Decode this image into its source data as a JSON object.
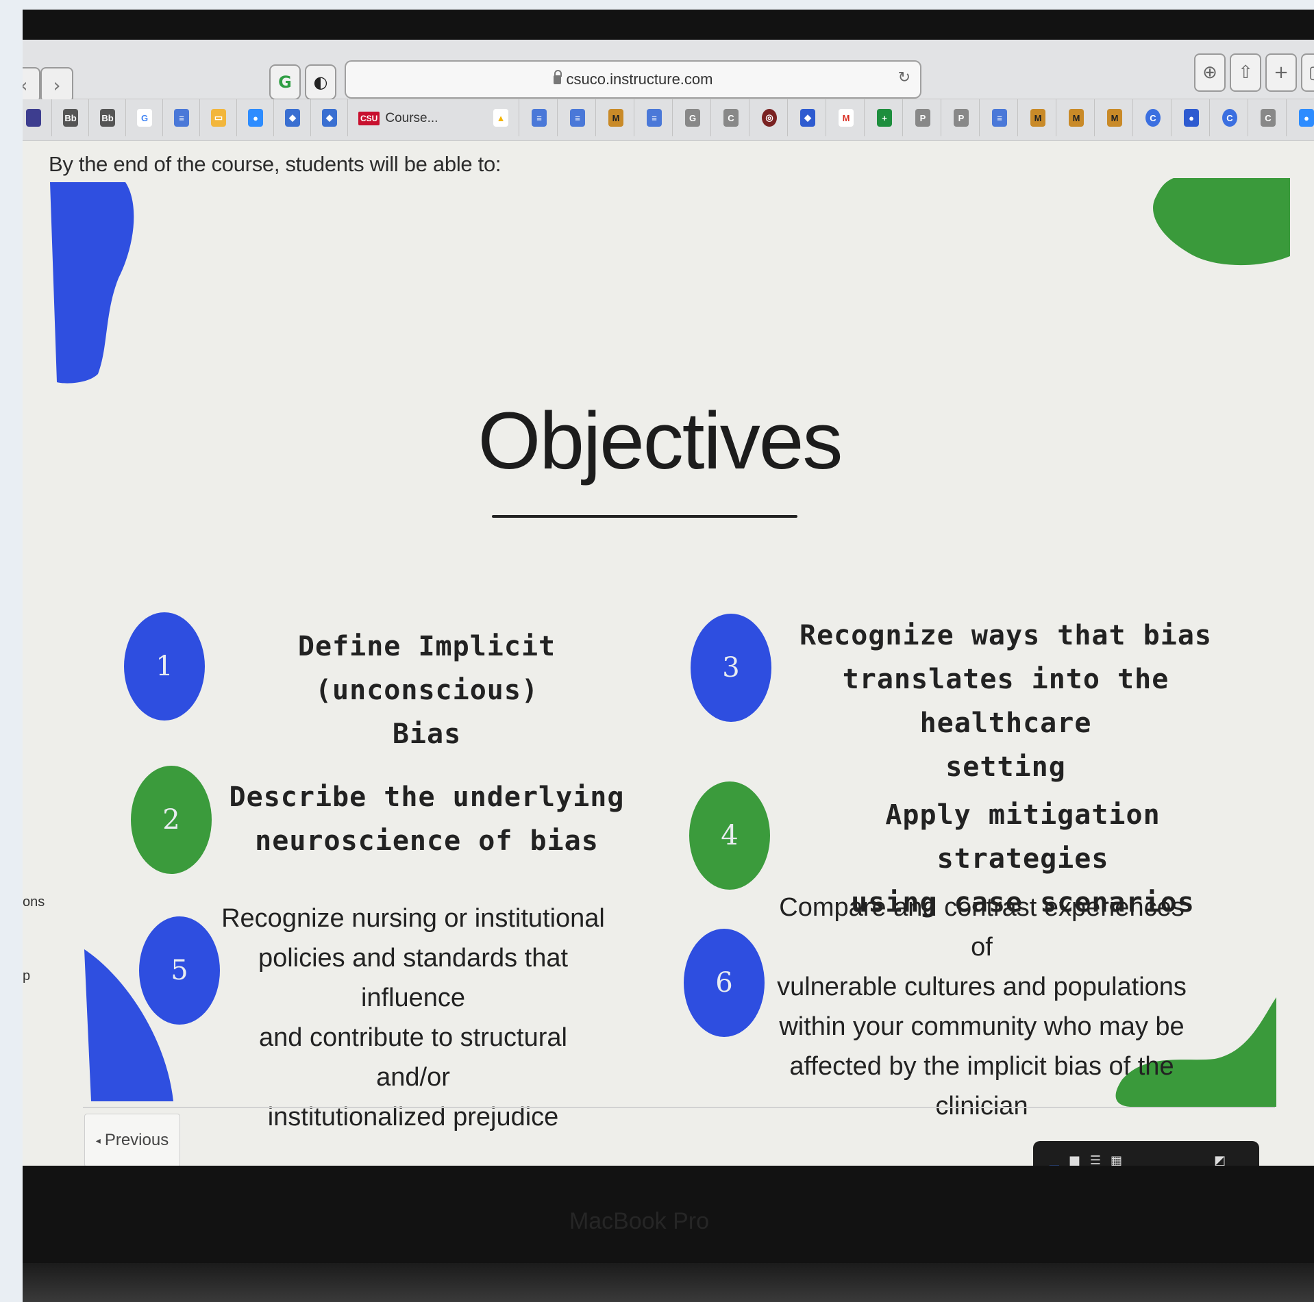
{
  "browser": {
    "url": "csuco.instructure.com",
    "course_tab_label": "Course...",
    "course_tab_badge": "CSU",
    "bookmark_glyphs": [
      "Bb",
      "Bb",
      "G",
      "≡",
      "▭",
      "●",
      "◆",
      "◆",
      "▲",
      "≡",
      "≡",
      "M",
      "≡",
      "G",
      "C",
      "◎",
      "◆",
      "M",
      "+",
      "P",
      "P",
      "≡",
      "M",
      "M",
      "M",
      "C",
      "●",
      "C",
      "C",
      "●"
    ]
  },
  "page": {
    "lead_text": "By the end of the course, students will be able to:",
    "title": "Objectives",
    "previous_label": "Previous",
    "side_fragment_1": "ons",
    "side_fragment_2": "p"
  },
  "objectives": [
    {
      "number": "1",
      "text_line1": "Define Implicit (unconscious)",
      "text_line2": "Bias",
      "color": "#2e4ee0"
    },
    {
      "number": "2",
      "text_line1": "Describe the underlying",
      "text_line2": "neuroscience of bias",
      "color": "#3b9b3c"
    },
    {
      "number": "3",
      "text_line1": "Recognize ways that bias",
      "text_line2": "translates into the healthcare",
      "text_line3": "setting",
      "color": "#2e4ee0"
    },
    {
      "number": "4",
      "text_line1": "Apply mitigation strategies",
      "text_line2": "using case scenarios",
      "color": "#3b9b3c"
    },
    {
      "number": "5",
      "text_line1": "Recognize nursing or institutional",
      "text_line2": "policies and standards that influence",
      "text_line3": "and contribute to structural and/or",
      "text_line4": "institutionalized prejudice",
      "color": "#2e4ee0"
    },
    {
      "number": "6",
      "text_line1": "Compare and contrast experiences of",
      "text_line2": "vulnerable cultures and populations",
      "text_line3": "within your community who may be",
      "text_line4": "affected by the implicit bias of the",
      "text_line5": "clinician",
      "color": "#2e4ee0"
    }
  ],
  "device": {
    "chin_label": "MacBook Pro"
  },
  "colors": {
    "accent_blue": "#2e4ee0",
    "accent_green": "#3b9b3c"
  }
}
